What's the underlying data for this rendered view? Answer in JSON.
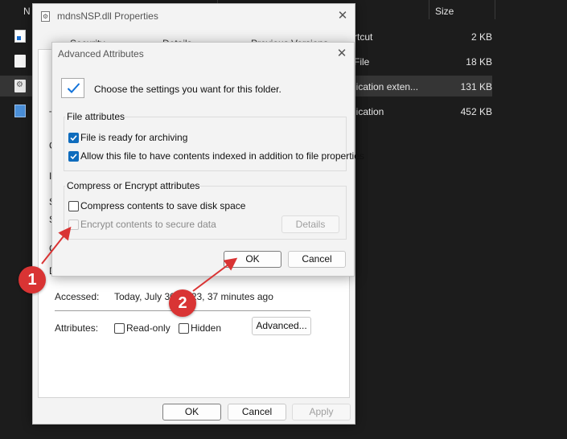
{
  "explorer": {
    "col_name": "N",
    "col_size": "Size",
    "rows": [
      {
        "type": "rtcut",
        "size": "2 KB",
        "icon": "shortcut-file-icon"
      },
      {
        "type": "File",
        "size": "18 KB",
        "icon": "document-file-icon"
      },
      {
        "type": "lication exten...",
        "size": "131 KB",
        "icon": "dll-file-icon"
      },
      {
        "type": "lication",
        "size": "452 KB",
        "icon": "application-file-icon"
      }
    ]
  },
  "properties": {
    "title": "mdnsNSP.dll Properties",
    "close_glyph": "✕",
    "tabs": [
      "Security",
      "Details",
      "Previous Versions"
    ],
    "side_letters": [
      "T",
      "C",
      "I",
      "S",
      "S",
      "C",
      "D"
    ],
    "accessed_label": "Accessed:",
    "accessed_value": "Today, July 30, 2023, 37 minutes ago",
    "attributes_label": "Attributes:",
    "readonly_label": "Read-only",
    "hidden_label": "Hidden",
    "advanced_button": "Advanced...",
    "ok_button": "OK",
    "cancel_button": "Cancel",
    "apply_button": "Apply"
  },
  "advanced": {
    "title": "Advanced Attributes",
    "close_glyph": "✕",
    "intro": "Choose the settings you want for this folder.",
    "file_attributes_title": "File attributes",
    "archive_label": "File is ready for archiving",
    "archive_checked": true,
    "index_label": "Allow this file to have contents indexed in addition to file properties",
    "index_checked": true,
    "compress_group_title": "Compress or Encrypt attributes",
    "compress_label": "Compress contents to save disk space",
    "compress_checked": false,
    "encrypt_label": "Encrypt contents to secure data",
    "encrypt_checked": false,
    "details_button": "Details",
    "ok_button": "OK",
    "cancel_button": "Cancel"
  },
  "annotations": {
    "callout_1": "1",
    "callout_2": "2",
    "color": "#d93434"
  }
}
